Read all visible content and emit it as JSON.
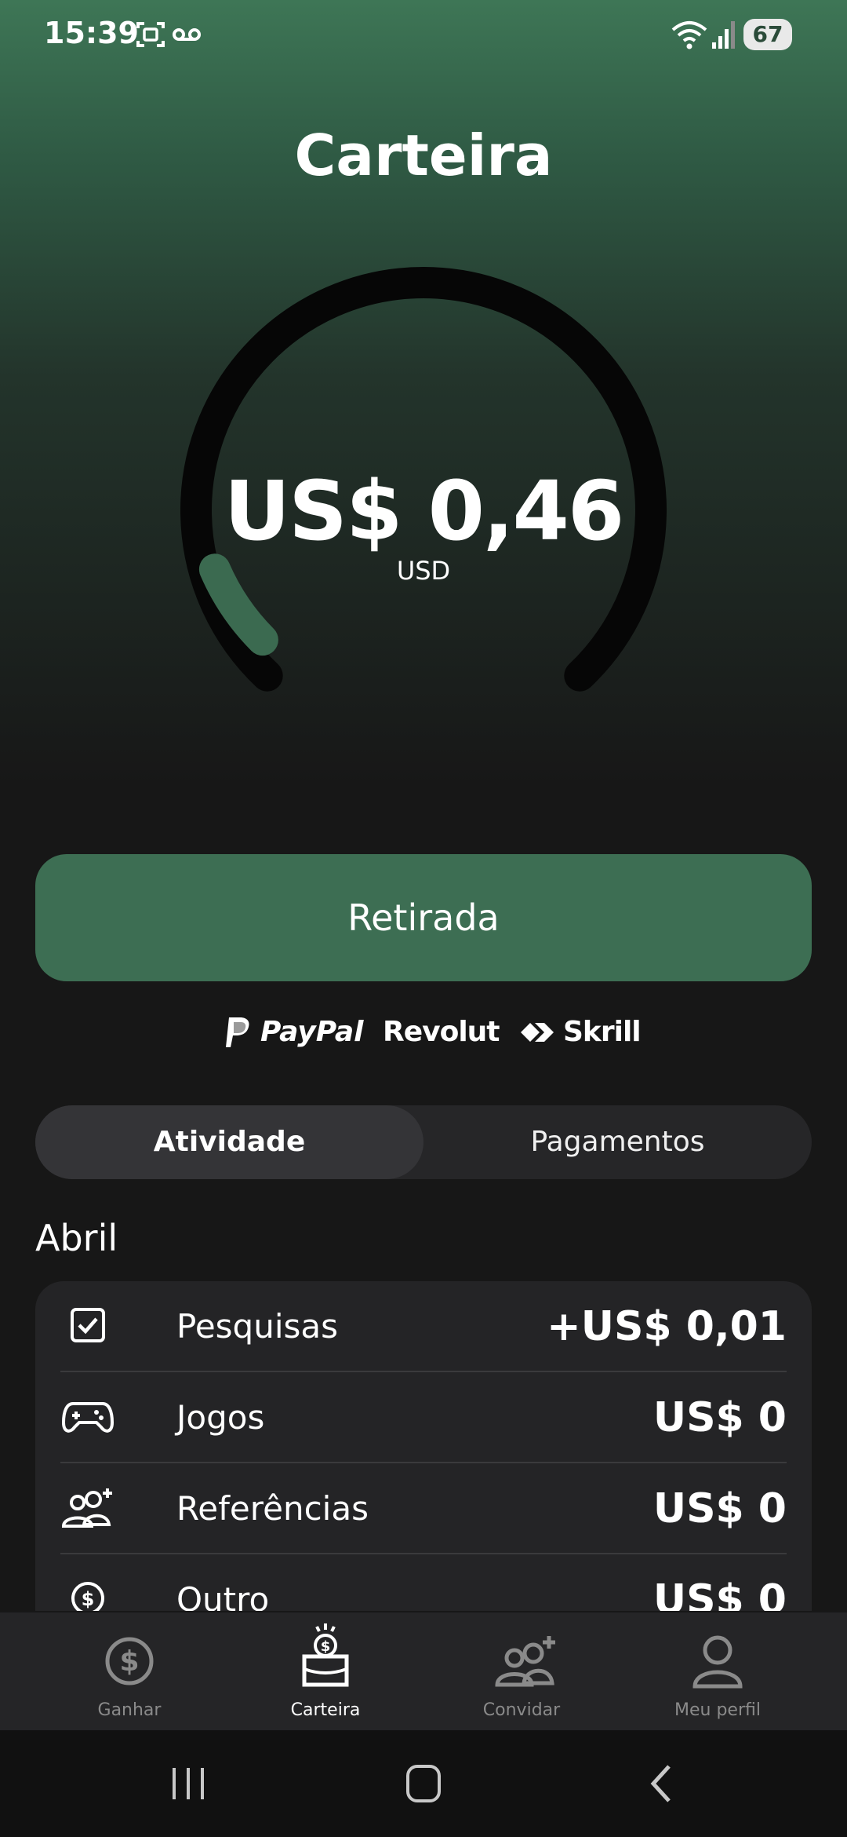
{
  "status_bar": {
    "time": "15:39",
    "battery": "67",
    "icons": [
      "screenshot-icon",
      "voicemail-icon",
      "wifi-icon",
      "signal-icon"
    ]
  },
  "page": {
    "title": "Carteira"
  },
  "wallet": {
    "balance": "US$ 0,46",
    "currency": "USD",
    "gauge_progress": 0.08
  },
  "withdraw_label": "Retirada",
  "providers": [
    "PayPal",
    "Revolut",
    "Skrill"
  ],
  "tabs": {
    "activity": "Atividade",
    "payments": "Pagamentos"
  },
  "month": "Abril",
  "activity": [
    {
      "icon": "checkbox-icon",
      "label": "Pesquisas",
      "amount": "+US$ 0,01"
    },
    {
      "icon": "gamepad-icon",
      "label": "Jogos",
      "amount": "US$ 0"
    },
    {
      "icon": "referrals-icon",
      "label": "Referências",
      "amount": "US$ 0"
    },
    {
      "icon": "dollar-coin-icon",
      "label": "Outro",
      "amount": "US$ 0"
    }
  ],
  "bottom_nav": [
    {
      "icon": "dollar-icon",
      "label": "Ganhar"
    },
    {
      "icon": "wallet-icon",
      "label": "Carteira"
    },
    {
      "icon": "invite-icon",
      "label": "Convidar"
    },
    {
      "icon": "profile-icon",
      "label": "Meu perfil"
    }
  ],
  "colors": {
    "accent": "#3d6e53",
    "gradient_top": "#3e7656",
    "background": "#171717",
    "card": "#242426"
  }
}
